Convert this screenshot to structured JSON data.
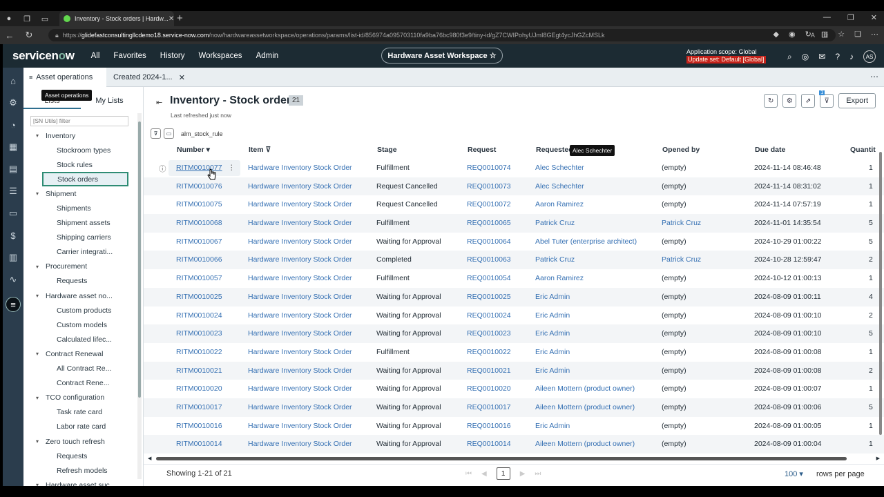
{
  "browser": {
    "tab_title": "Inventory - Stock orders | Hardw...",
    "tab_close": "✕",
    "new_tab": "+",
    "url_prefix": "https://",
    "url_host": "glidefastconsultingllcdemo18.service-now.com",
    "url_path": "/now/hardwareassetworkspace/operations/params/list-id/856974a095703110fa9ba76bc980f3e9/tiny-id/gZ7CWIPohyUJmI8GEgt4ycJhGZcMSLk"
  },
  "header": {
    "logo_a": "servicen",
    "logo_o": "o",
    "logo_b": "w",
    "nav": [
      "All",
      "Favorites",
      "History",
      "Workspaces",
      "Admin"
    ],
    "workspace_button": "Hardware Asset Workspace ☆",
    "scope_line": "Application scope: Global",
    "update_set": "Update set: Default [Global]",
    "avatar": "AS"
  },
  "workspace_tabs": {
    "tab1": "Asset operations",
    "tab2": "Created 2024-1...",
    "tab2_close": "✕"
  },
  "left_panel": {
    "tooltip": "Asset operations",
    "tab_lists": "Lists",
    "tab_my_lists": "My Lists",
    "filter_placeholder": "[SN Utils] filter",
    "tree": [
      {
        "type": "g",
        "label": "Inventory"
      },
      {
        "type": "c",
        "label": "Stockroom types"
      },
      {
        "type": "c",
        "label": "Stock rules"
      },
      {
        "type": "c",
        "label": "Stock orders",
        "selected": true
      },
      {
        "type": "g",
        "label": "Shipment"
      },
      {
        "type": "c",
        "label": "Shipments"
      },
      {
        "type": "c",
        "label": "Shipment assets"
      },
      {
        "type": "c",
        "label": "Shipping carriers"
      },
      {
        "type": "c",
        "label": "Carrier integrati..."
      },
      {
        "type": "g",
        "label": "Procurement"
      },
      {
        "type": "c",
        "label": "Requests"
      },
      {
        "type": "g",
        "label": "Hardware asset no..."
      },
      {
        "type": "c",
        "label": "Custom products"
      },
      {
        "type": "c",
        "label": "Custom models"
      },
      {
        "type": "c",
        "label": "Calculated lifec..."
      },
      {
        "type": "g",
        "label": "Contract Renewal"
      },
      {
        "type": "c",
        "label": "All Contract Re..."
      },
      {
        "type": "c",
        "label": "Contract Rene..."
      },
      {
        "type": "g",
        "label": "TCO configuration"
      },
      {
        "type": "c",
        "label": "Task rate card"
      },
      {
        "type": "c",
        "label": "Labor rate card"
      },
      {
        "type": "g",
        "label": "Zero touch refresh"
      },
      {
        "type": "c",
        "label": "Requests"
      },
      {
        "type": "c",
        "label": "Refresh models"
      },
      {
        "type": "g",
        "label": "Hardware asset suc..."
      }
    ]
  },
  "list": {
    "title": "Inventory - Stock orders",
    "count": "21",
    "refreshed": "Last refreshed just now",
    "condition": "alm_stock_rule",
    "export": "Export",
    "filter_badge": "1",
    "tooltip": "Alec Schechter",
    "columns": {
      "number": "Number ▾",
      "item": "Item ⊽",
      "stage": "Stage",
      "request": "Request",
      "requested_for": "Requested",
      "opened_by": "Opened by",
      "due_date": "Due date",
      "quantity": "Quantit"
    },
    "rows": [
      {
        "number": "RITM0010077",
        "item": "Hardware Inventory Stock Order",
        "stage": "Fulfillment",
        "request": "REQ0010074",
        "requested_for": "Alec Schechter",
        "opened_by": "(empty)",
        "opened_link": false,
        "due": "2024-11-14 08:46:48",
        "qty": "1"
      },
      {
        "number": "RITM0010076",
        "item": "Hardware Inventory Stock Order",
        "stage": "Request Cancelled",
        "request": "REQ0010073",
        "requested_for": "Alec Schechter",
        "opened_by": "(empty)",
        "opened_link": false,
        "due": "2024-11-14 08:31:02",
        "qty": "1"
      },
      {
        "number": "RITM0010075",
        "item": "Hardware Inventory Stock Order",
        "stage": "Request Cancelled",
        "request": "REQ0010072",
        "requested_for": "Aaron Ramirez",
        "opened_by": "(empty)",
        "opened_link": false,
        "due": "2024-11-14 07:57:19",
        "qty": "1"
      },
      {
        "number": "RITM0010068",
        "item": "Hardware Inventory Stock Order",
        "stage": "Fulfillment",
        "request": "REQ0010065",
        "requested_for": "Patrick Cruz",
        "opened_by": "Patrick Cruz",
        "opened_link": true,
        "due": "2024-11-01 14:35:54",
        "qty": "5"
      },
      {
        "number": "RITM0010067",
        "item": "Hardware Inventory Stock Order",
        "stage": "Waiting for Approval",
        "request": "REQ0010064",
        "requested_for": "Abel Tuter (enterprise architect)",
        "opened_by": "(empty)",
        "opened_link": false,
        "due": "2024-10-29 01:00:22",
        "qty": "5"
      },
      {
        "number": "RITM0010066",
        "item": "Hardware Inventory Stock Order",
        "stage": "Completed",
        "request": "REQ0010063",
        "requested_for": "Patrick Cruz",
        "opened_by": "Patrick Cruz",
        "opened_link": true,
        "due": "2024-10-28 12:59:47",
        "qty": "2"
      },
      {
        "number": "RITM0010057",
        "item": "Hardware Inventory Stock Order",
        "stage": "Fulfillment",
        "request": "REQ0010054",
        "requested_for": "Aaron Ramirez",
        "opened_by": "(empty)",
        "opened_link": false,
        "due": "2024-10-12 01:00:13",
        "qty": "1"
      },
      {
        "number": "RITM0010025",
        "item": "Hardware Inventory Stock Order",
        "stage": "Waiting for Approval",
        "request": "REQ0010025",
        "requested_for": "Eric Admin",
        "opened_by": "(empty)",
        "opened_link": false,
        "due": "2024-08-09 01:00:11",
        "qty": "4"
      },
      {
        "number": "RITM0010024",
        "item": "Hardware Inventory Stock Order",
        "stage": "Waiting for Approval",
        "request": "REQ0010024",
        "requested_for": "Eric Admin",
        "opened_by": "(empty)",
        "opened_link": false,
        "due": "2024-08-09 01:00:10",
        "qty": "2"
      },
      {
        "number": "RITM0010023",
        "item": "Hardware Inventory Stock Order",
        "stage": "Waiting for Approval",
        "request": "REQ0010023",
        "requested_for": "Eric Admin",
        "opened_by": "(empty)",
        "opened_link": false,
        "due": "2024-08-09 01:00:10",
        "qty": "5"
      },
      {
        "number": "RITM0010022",
        "item": "Hardware Inventory Stock Order",
        "stage": "Fulfillment",
        "request": "REQ0010022",
        "requested_for": "Eric Admin",
        "opened_by": "(empty)",
        "opened_link": false,
        "due": "2024-08-09 01:00:08",
        "qty": "1"
      },
      {
        "number": "RITM0010021",
        "item": "Hardware Inventory Stock Order",
        "stage": "Waiting for Approval",
        "request": "REQ0010021",
        "requested_for": "Eric Admin",
        "opened_by": "(empty)",
        "opened_link": false,
        "due": "2024-08-09 01:00:08",
        "qty": "2"
      },
      {
        "number": "RITM0010020",
        "item": "Hardware Inventory Stock Order",
        "stage": "Waiting for Approval",
        "request": "REQ0010020",
        "requested_for": "Aileen Mottern (product owner)",
        "opened_by": "(empty)",
        "opened_link": false,
        "due": "2024-08-09 01:00:07",
        "qty": "1"
      },
      {
        "number": "RITM0010017",
        "item": "Hardware Inventory Stock Order",
        "stage": "Waiting for Approval",
        "request": "REQ0010017",
        "requested_for": "Aileen Mottern (product owner)",
        "opened_by": "(empty)",
        "opened_link": false,
        "due": "2024-08-09 01:00:06",
        "qty": "5"
      },
      {
        "number": "RITM0010016",
        "item": "Hardware Inventory Stock Order",
        "stage": "Waiting for Approval",
        "request": "REQ0010016",
        "requested_for": "Eric Admin",
        "opened_by": "(empty)",
        "opened_link": false,
        "due": "2024-08-09 01:00:05",
        "qty": "1"
      },
      {
        "number": "RITM0010014",
        "item": "Hardware Inventory Stock Order",
        "stage": "Waiting for Approval",
        "request": "REQ0010014",
        "requested_for": "Aileen Mottern (product owner)",
        "opened_by": "(empty)",
        "opened_link": false,
        "due": "2024-08-09 01:00:04",
        "qty": "1"
      }
    ],
    "showing": "Showing 1-21 of 21",
    "page": "1",
    "rows_per_page_value": "100 ▾",
    "rows_per_page_label": "rows per page"
  },
  "colors": {
    "header_bg": "#1c2b33",
    "rail_bg": "#2b3d4d",
    "link": "#3570b3",
    "accent": "#2e8c74"
  }
}
